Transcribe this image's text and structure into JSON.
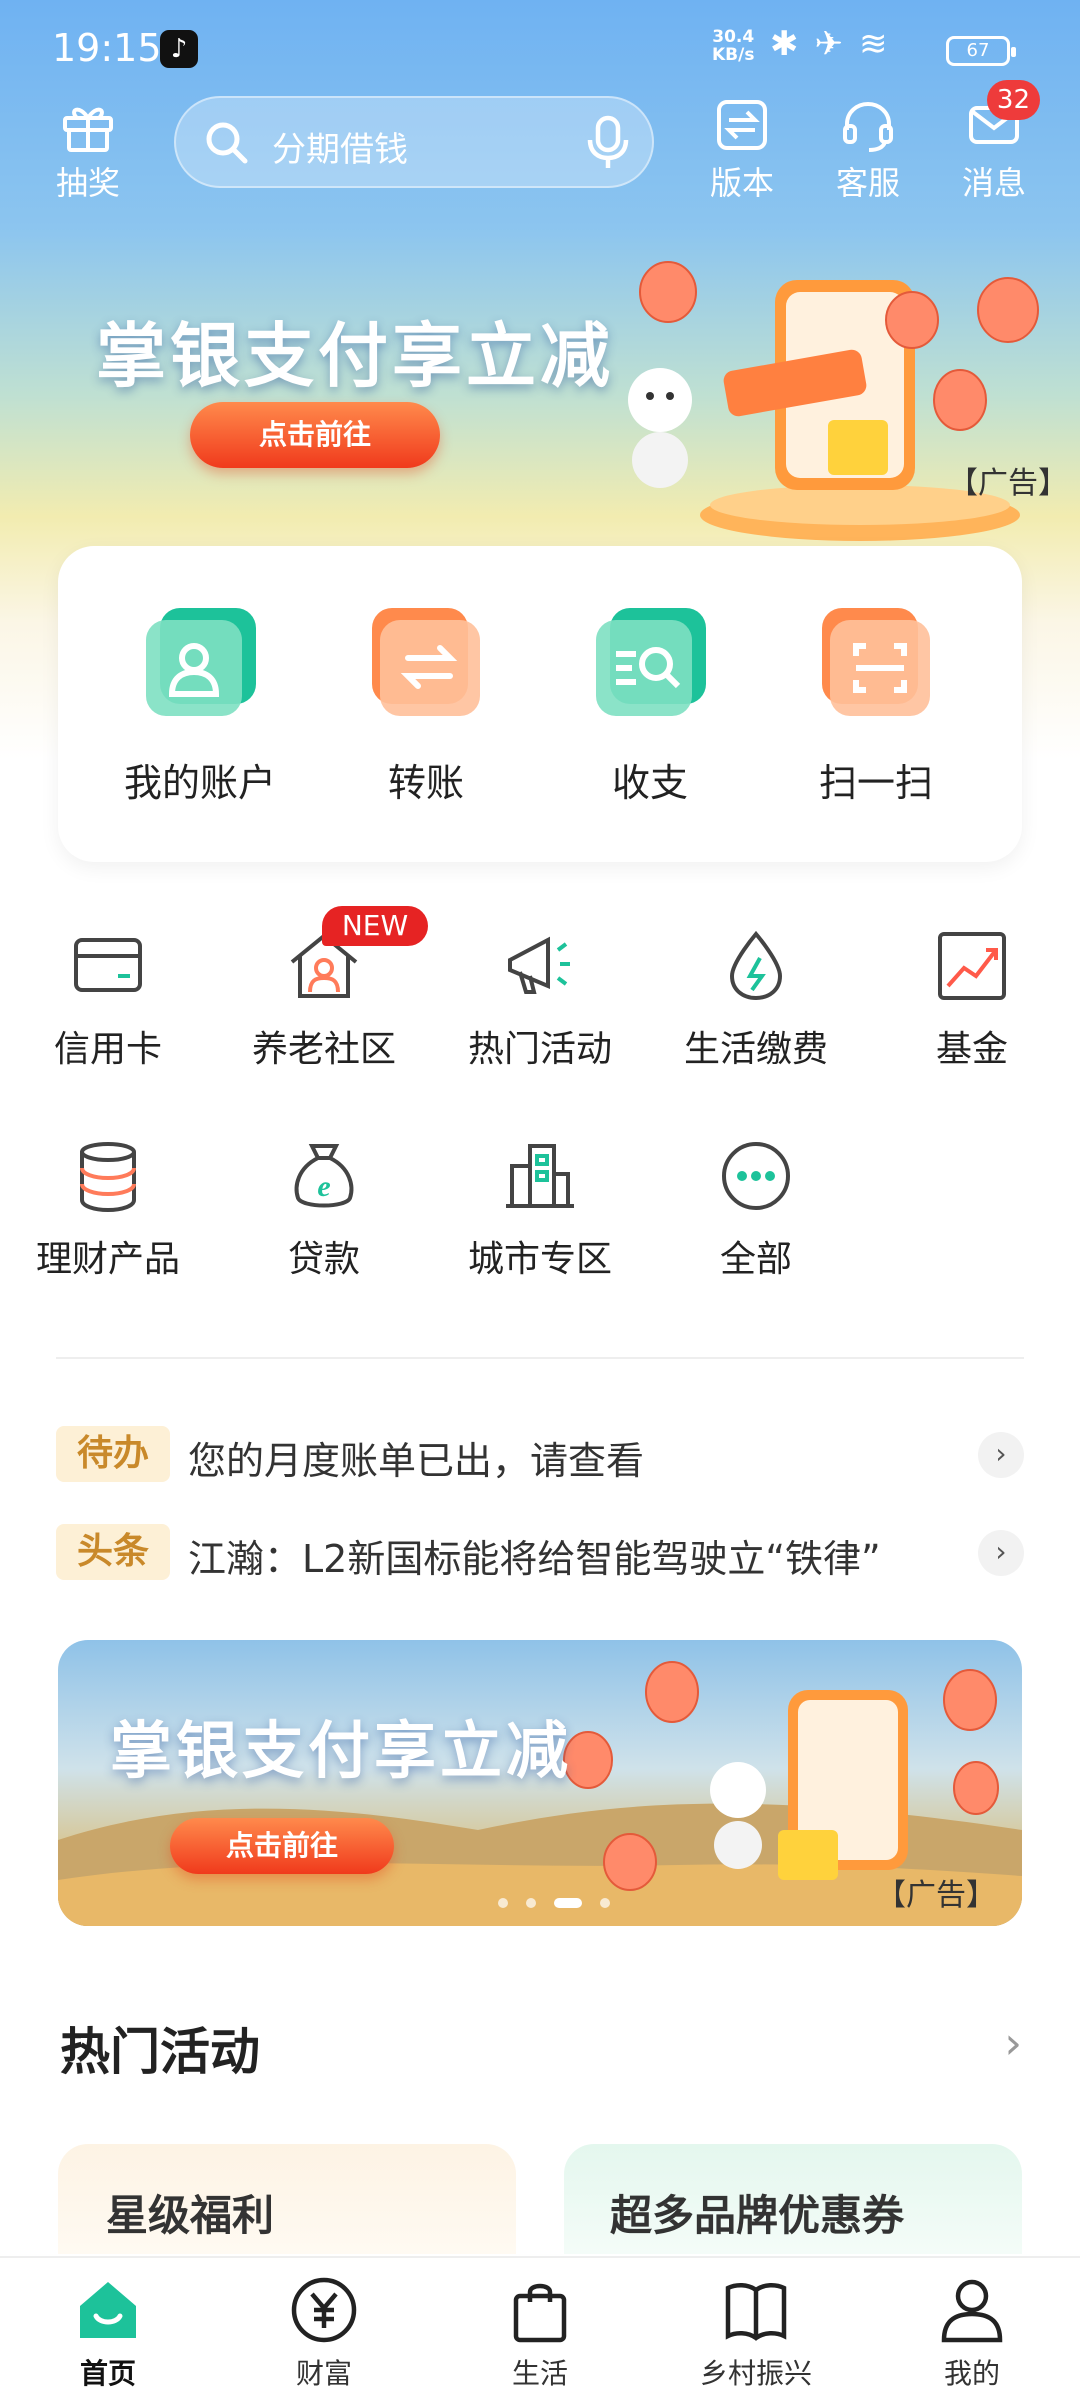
{
  "status_bar": {
    "time": "19:15",
    "net_speed": "30.4",
    "net_unit": "KB/s",
    "battery": "67"
  },
  "header": {
    "lottery_label": "抽奖",
    "search_placeholder": "分期借钱",
    "version_label": "版本",
    "service_label": "客服",
    "message_label": "消息",
    "message_badge": "32"
  },
  "banner_top": {
    "title": "掌银支付享立减",
    "cta": "点击前往",
    "ad_label": "【广告】"
  },
  "quick_actions": [
    {
      "label": "我的账户",
      "icon": "account-icon"
    },
    {
      "label": "转账",
      "icon": "transfer-icon"
    },
    {
      "label": "收支",
      "icon": "income-expense-icon"
    },
    {
      "label": "扫一扫",
      "icon": "scan-icon"
    }
  ],
  "grid_row1": [
    {
      "label": "信用卡",
      "icon": "credit-card-icon"
    },
    {
      "label": "养老社区",
      "icon": "elderly-community-icon",
      "tag": "NEW"
    },
    {
      "label": "热门活动",
      "icon": "megaphone-icon"
    },
    {
      "label": "生活缴费",
      "icon": "utility-payment-icon"
    },
    {
      "label": "基金",
      "icon": "fund-chart-icon"
    }
  ],
  "grid_row2": [
    {
      "label": "理财产品",
      "icon": "coin-stack-icon"
    },
    {
      "label": "贷款",
      "icon": "loan-bag-icon"
    },
    {
      "label": "城市专区",
      "icon": "city-building-icon"
    },
    {
      "label": "全部",
      "icon": "more-icon"
    }
  ],
  "notices": [
    {
      "tag": "待办",
      "text": "您的月度账单已出，请查看"
    },
    {
      "tag": "头条",
      "text": "江瀚：L2新国标能将给智能驾驶立“铁律”"
    }
  ],
  "banner_mid": {
    "title": "掌银支付享立减",
    "cta": "点击前往",
    "ad_label": "【广告】"
  },
  "hot_section": {
    "title": "热门活动"
  },
  "cards": [
    {
      "title": "星级福利"
    },
    {
      "title": "超多品牌优惠券"
    }
  ],
  "tabs": [
    {
      "label": "首页",
      "icon": "home-icon",
      "active": true
    },
    {
      "label": "财富",
      "icon": "wealth-icon"
    },
    {
      "label": "生活",
      "icon": "shopping-bag-icon"
    },
    {
      "label": "乡村振兴",
      "icon": "book-icon"
    },
    {
      "label": "我的",
      "icon": "user-icon"
    }
  ],
  "colors": {
    "accent_green": "#1dc29a",
    "accent_orange": "#ff8a4c",
    "badge_red": "#ee3b3b"
  }
}
